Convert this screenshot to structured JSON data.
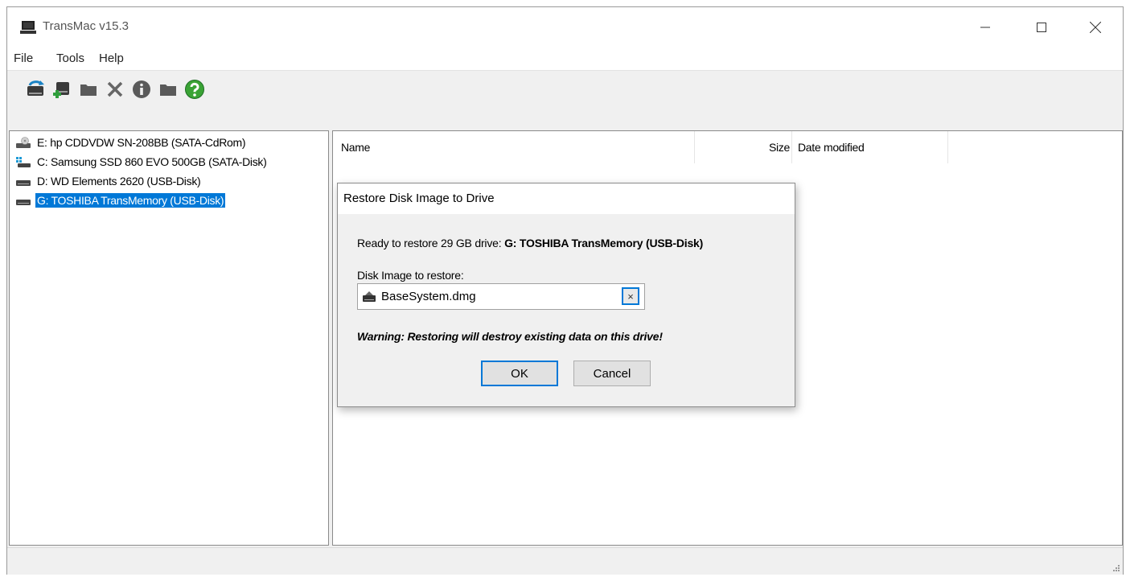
{
  "window": {
    "title": "TransMac v15.3"
  },
  "menu": [
    "File",
    "Tools",
    "Help"
  ],
  "toolbar": {
    "icons": [
      "refresh-drives-icon",
      "add-drive-icon",
      "folder-icon",
      "delete-icon",
      "info-icon",
      "folder-icon",
      "help-icon"
    ]
  },
  "drives": [
    {
      "label": "E: hp CDDVDW SN-208BB (SATA-CdRom)",
      "icon": "cdrom-drive-icon"
    },
    {
      "label": "C:  Samsung SSD 860 EVO 500GB (SATA-Disk)",
      "icon": "system-disk-icon"
    },
    {
      "label": "D: WD Elements 2620 (USB-Disk)",
      "icon": "usb-disk-icon"
    },
    {
      "label": "G: TOSHIBA TransMemory (USB-Disk)",
      "icon": "usb-disk-icon",
      "selected": true
    }
  ],
  "columns": {
    "name": "Name",
    "size": "Size",
    "date": "Date modified"
  },
  "dialog": {
    "title": "Restore Disk Image to Drive",
    "message_prefix": "Ready to restore 29 GB drive: ",
    "message_drive": "G: TOSHIBA TransMemory (USB-Disk)",
    "field_label": "Disk Image to restore:",
    "field_value": "BaseSystem.dmg",
    "clear_glyph": "×",
    "warning": "Warning: Restoring will destroy existing data on this drive!",
    "ok_label": "OK",
    "cancel_label": "Cancel"
  },
  "colors": {
    "selection": "#0078d7",
    "focus_border": "#0078d7",
    "help_icon": "#3aa335"
  }
}
